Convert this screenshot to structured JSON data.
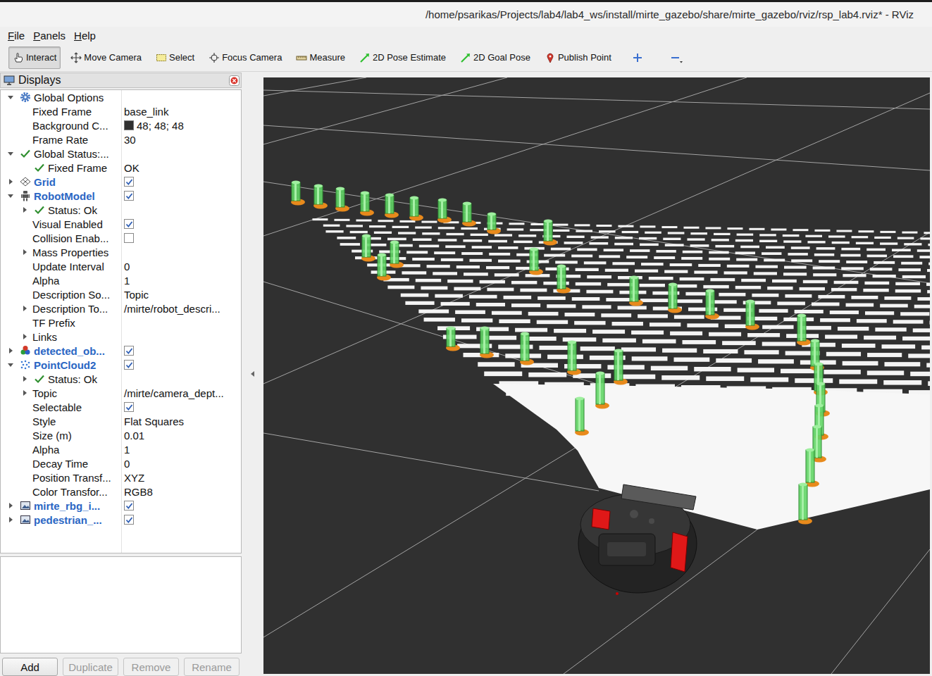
{
  "window": {
    "title": "/home/psarikas/Projects/lab4/lab4_ws/install/mirte_gazebo/share/mirte_gazebo/rviz/rsp_lab4.rviz* - RViz"
  },
  "menu": [
    "File",
    "Panels",
    "Help"
  ],
  "toolbar": [
    {
      "label": "Interact",
      "selected": true
    },
    {
      "label": "Move Camera",
      "selected": false
    },
    {
      "label": "Select",
      "selected": false
    },
    {
      "label": "Focus Camera",
      "selected": false
    },
    {
      "label": "Measure",
      "selected": false
    },
    {
      "label": "2D Pose Estimate",
      "selected": false
    },
    {
      "label": "2D Goal Pose",
      "selected": false
    },
    {
      "label": "Publish Point",
      "selected": false
    }
  ],
  "displays": {
    "title": "Displays",
    "rows": [
      {
        "label": "Global Options",
        "kind": "group",
        "depth": 0,
        "expandable": true,
        "expanded": true
      },
      {
        "label": "Fixed Frame",
        "kind": "property",
        "depth": 1,
        "expandable": false,
        "expanded": false,
        "value": "base_link"
      },
      {
        "label": "Background C...",
        "kind": "property",
        "depth": 1,
        "expandable": false,
        "expanded": false,
        "value": "48; 48; 48",
        "swatch": "#303030"
      },
      {
        "label": "Frame Rate",
        "kind": "property",
        "depth": 1,
        "expandable": false,
        "expanded": false,
        "value": "30"
      },
      {
        "label": "Global Status:...",
        "kind": "status",
        "depth": 0,
        "expandable": true,
        "expanded": true
      },
      {
        "label": "Fixed Frame",
        "kind": "status",
        "depth": 1,
        "expandable": false,
        "expanded": false,
        "value": "OK"
      },
      {
        "label": "Grid",
        "kind": "display",
        "depth": 0,
        "expandable": true,
        "expanded": false,
        "checked": true
      },
      {
        "label": "RobotModel",
        "kind": "display",
        "depth": 0,
        "expandable": true,
        "expanded": true,
        "checked": true
      },
      {
        "label": "Status: Ok",
        "kind": "status",
        "depth": 1,
        "expandable": true,
        "expanded": false
      },
      {
        "label": "Visual Enabled",
        "kind": "bool",
        "depth": 1,
        "expandable": false,
        "expanded": false,
        "checked": true
      },
      {
        "label": "Collision Enab...",
        "kind": "bool",
        "depth": 1,
        "expandable": false,
        "expanded": false,
        "checked": false
      },
      {
        "label": "Mass Properties",
        "kind": "property",
        "depth": 1,
        "expandable": true,
        "expanded": false
      },
      {
        "label": "Update Interval",
        "kind": "property",
        "depth": 1,
        "expandable": false,
        "expanded": false,
        "value": "0"
      },
      {
        "label": "Alpha",
        "kind": "property",
        "depth": 1,
        "expandable": false,
        "expanded": false,
        "value": "1"
      },
      {
        "label": "Description So...",
        "kind": "property",
        "depth": 1,
        "expandable": false,
        "expanded": false,
        "value": "Topic"
      },
      {
        "label": "Description To...",
        "kind": "property",
        "depth": 1,
        "expandable": true,
        "expanded": false,
        "value": "/mirte/robot_descri..."
      },
      {
        "label": "TF Prefix",
        "kind": "property",
        "depth": 1,
        "expandable": false,
        "expanded": false
      },
      {
        "label": "Links",
        "kind": "property",
        "depth": 1,
        "expandable": true,
        "expanded": false
      },
      {
        "label": "detected_ob...",
        "kind": "display",
        "depth": 0,
        "expandable": true,
        "expanded": false,
        "checked": true
      },
      {
        "label": "PointCloud2",
        "kind": "display",
        "depth": 0,
        "expandable": true,
        "expanded": true,
        "checked": true
      },
      {
        "label": "Status: Ok",
        "kind": "status",
        "depth": 1,
        "expandable": true,
        "expanded": false
      },
      {
        "label": "Topic",
        "kind": "property",
        "depth": 1,
        "expandable": true,
        "expanded": false,
        "value": "/mirte/camera_dept..."
      },
      {
        "label": "Selectable",
        "kind": "bool",
        "depth": 1,
        "expandable": false,
        "expanded": false,
        "checked": true
      },
      {
        "label": "Style",
        "kind": "property",
        "depth": 1,
        "expandable": false,
        "expanded": false,
        "value": "Flat Squares"
      },
      {
        "label": "Size (m)",
        "kind": "property",
        "depth": 1,
        "expandable": false,
        "expanded": false,
        "value": "0.01"
      },
      {
        "label": "Alpha",
        "kind": "property",
        "depth": 1,
        "expandable": false,
        "expanded": false,
        "value": "1"
      },
      {
        "label": "Decay Time",
        "kind": "property",
        "depth": 1,
        "expandable": false,
        "expanded": false,
        "value": "0"
      },
      {
        "label": "Position Transf...",
        "kind": "property",
        "depth": 1,
        "expandable": false,
        "expanded": false,
        "value": "XYZ"
      },
      {
        "label": "Color Transfor...",
        "kind": "property",
        "depth": 1,
        "expandable": false,
        "expanded": false,
        "value": "RGB8"
      },
      {
        "label": "mirte_rbg_i...",
        "kind": "display",
        "depth": 0,
        "expandable": true,
        "expanded": false,
        "checked": true
      },
      {
        "label": "pedestrian_...",
        "kind": "display",
        "depth": 0,
        "expandable": true,
        "expanded": false,
        "checked": true
      }
    ]
  },
  "buttons": [
    {
      "label": "Add",
      "disabled": false
    },
    {
      "label": "Duplicate",
      "disabled": true
    },
    {
      "label": "Remove",
      "disabled": true
    },
    {
      "label": "Rename",
      "disabled": true
    }
  ]
}
